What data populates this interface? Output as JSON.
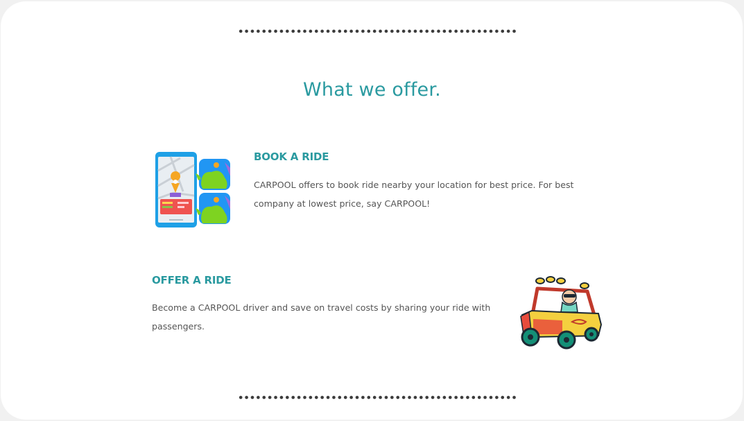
{
  "section": {
    "title": "What we offer."
  },
  "features": [
    {
      "heading": "BOOK A RIDE",
      "description": "CARPOOL offers to book ride nearby your location for best price. For best company at lowest price, say CARPOOL!",
      "illustration": "phone-map-icon"
    },
    {
      "heading": "OFFER A RIDE",
      "description": "Become a CARPOOL driver and save on travel costs by sharing your ride with passengers.",
      "illustration": "car-driver-icon"
    }
  ],
  "colors": {
    "accent": "#2a9aa0",
    "text": "#555555",
    "divider": "#3c3c3c",
    "background": "#ffffff"
  }
}
